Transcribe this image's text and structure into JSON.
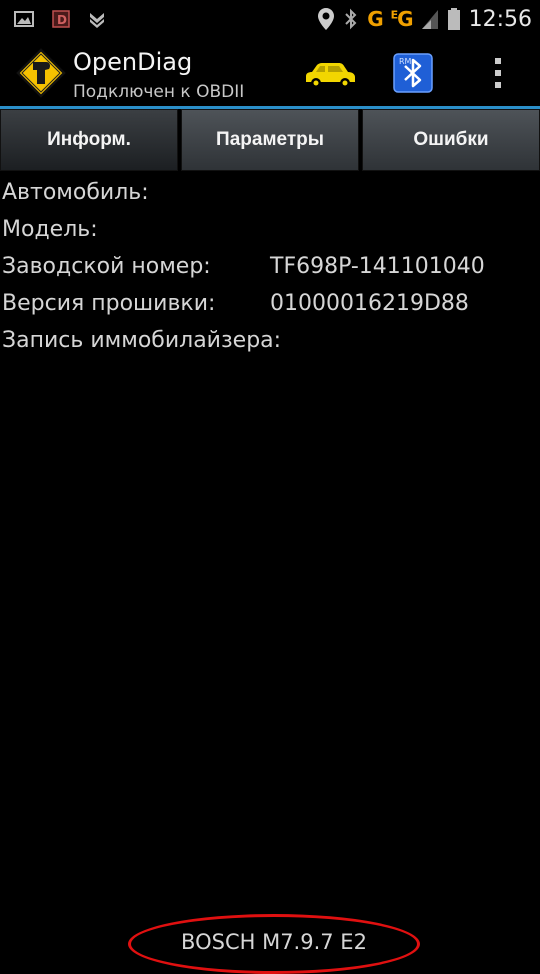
{
  "status_bar": {
    "icons_left": [
      "gallery-icon",
      "app-d-icon",
      "download-icon"
    ],
    "icons_right": [
      "location-icon",
      "bluetooth-icon",
      "signal-icon",
      "battery-icon"
    ],
    "network_1": "G",
    "network_2_sup": "E",
    "network_2": "G",
    "time": "12:56"
  },
  "action_bar": {
    "title": "OpenDiag",
    "subtitle": "Подключен к OBDII",
    "accent_color": "#2b8fc9",
    "car_icon_color": "#f2d600",
    "bt_badge": "RM"
  },
  "tabs": [
    {
      "label": "Информ.",
      "selected": true
    },
    {
      "label": "Параметры",
      "selected": false
    },
    {
      "label": "Ошибки",
      "selected": false
    }
  ],
  "info": [
    {
      "label": "Автомобиль:",
      "value": ""
    },
    {
      "label": "Модель:",
      "value": ""
    },
    {
      "label": "Заводской номер:",
      "value": "TF698P-141101040"
    },
    {
      "label": "Версия прошивки:",
      "value": "01000016219D88"
    },
    {
      "label": "Запись иммобилайзера:",
      "value": ""
    }
  ],
  "ecu": {
    "label": "BOSCH M7.9.7 E2",
    "highlight_color": "#e01010"
  }
}
